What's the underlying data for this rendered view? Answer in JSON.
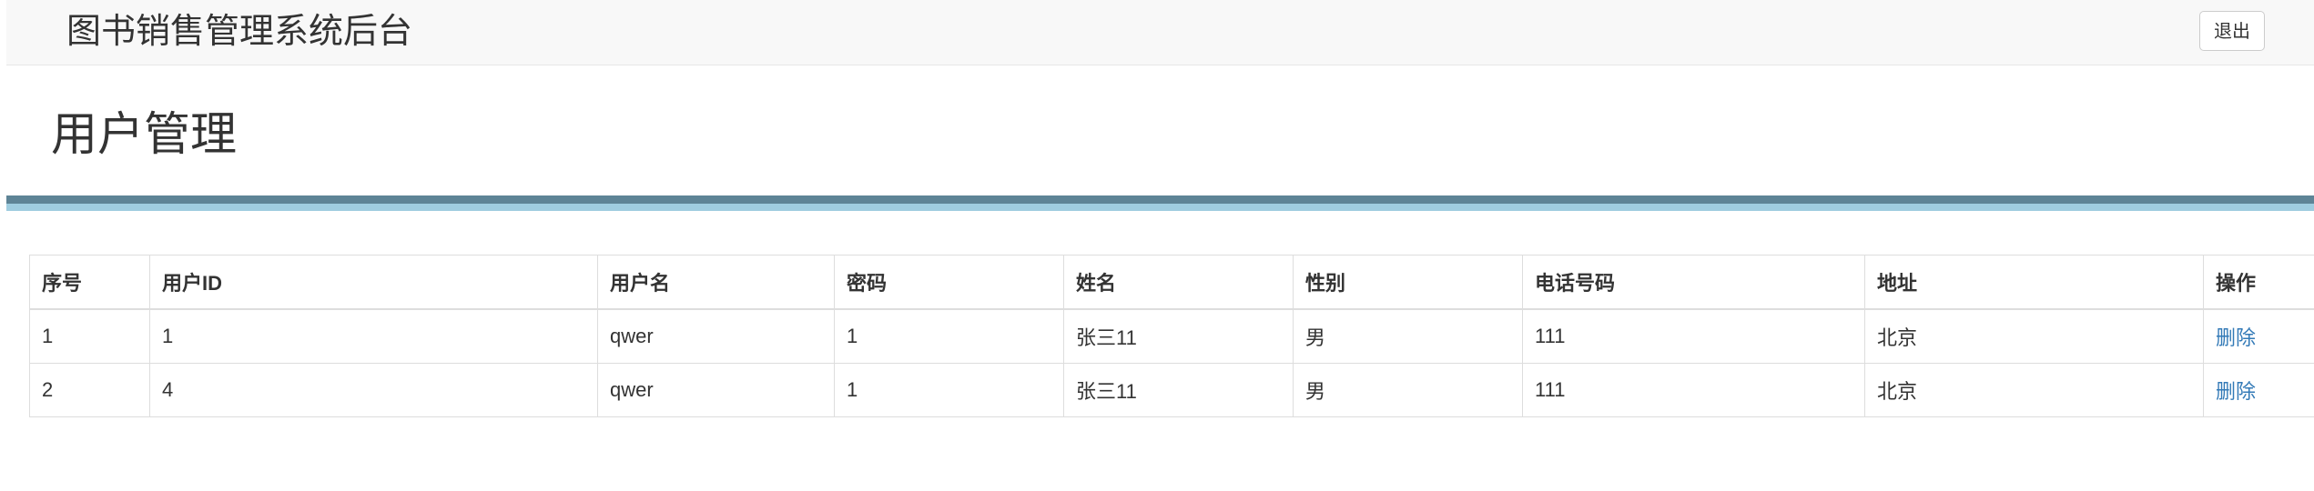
{
  "header": {
    "brand": "图书销售管理系统后台",
    "logout_label": "退出"
  },
  "page": {
    "title": "用户管理"
  },
  "colors": {
    "rule_dark": "#5e8496",
    "rule_light": "#9fcde0",
    "link": "#337ab7"
  },
  "table": {
    "columns": [
      "序号",
      "用户ID",
      "用户名",
      "密码",
      "姓名",
      "性别",
      "电话号码",
      "地址",
      "操作"
    ],
    "rows": [
      {
        "index": "1",
        "user_id": "1",
        "username": "qwer",
        "password": "1",
        "name": "张三11",
        "gender": "男",
        "phone": "111",
        "address": "北京",
        "action": "删除"
      },
      {
        "index": "2",
        "user_id": "4",
        "username": "qwer",
        "password": "1",
        "name": "张三11",
        "gender": "男",
        "phone": "111",
        "address": "北京",
        "action": "删除"
      }
    ]
  }
}
